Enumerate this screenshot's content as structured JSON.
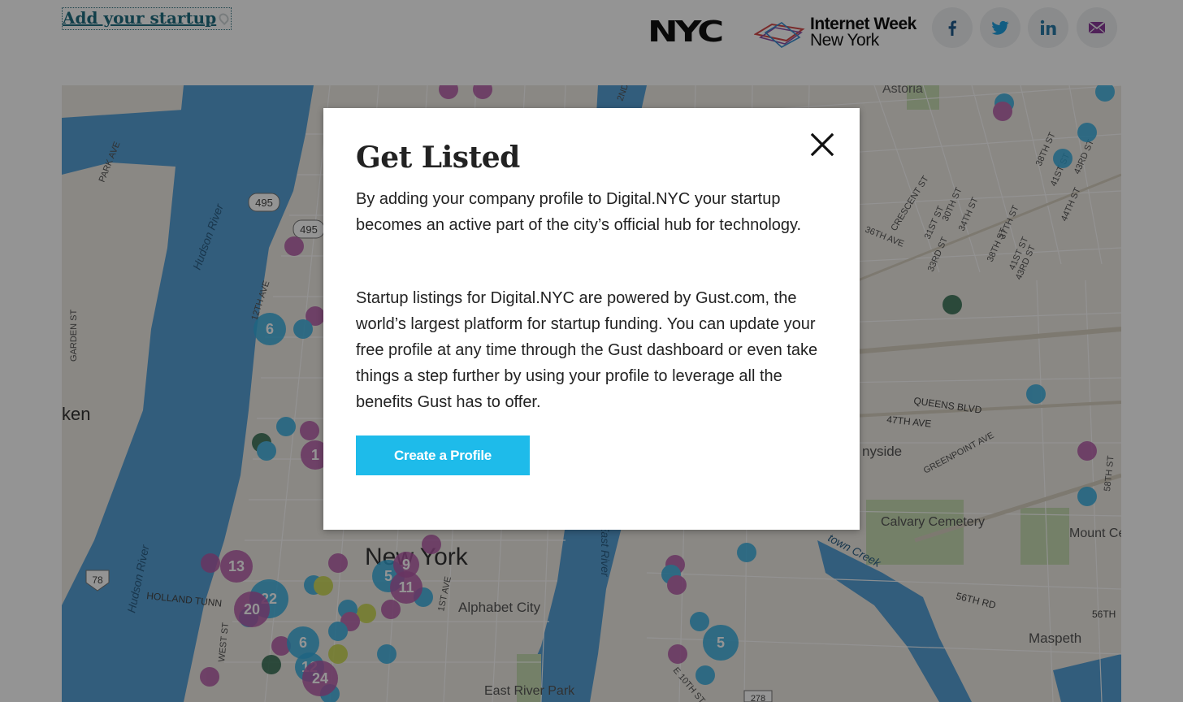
{
  "header": {
    "add_startup_link": "Add your startup",
    "nyc_logo": "NYC",
    "internet_week": {
      "line1": "Internet Week",
      "line2": "New York"
    },
    "social": [
      {
        "name": "facebook-icon",
        "color": "#1f5a8c"
      },
      {
        "name": "twitter-icon",
        "color": "#1fa0e0"
      },
      {
        "name": "linkedin-icon",
        "color": "#2a7aa8"
      },
      {
        "name": "email-icon",
        "color": "#8a3b9a"
      }
    ]
  },
  "map": {
    "labels": {
      "astoria": "Astoria",
      "park_ave": "PARK AVE",
      "hudson_river": "Hudson River",
      "hudson_river_2": "Hudson River",
      "rt495_a": "495",
      "rt495_b": "495",
      "rt78": "78",
      "rt278": "278",
      "ave12": "12TH AVE",
      "garden_st": "GARDEN ST",
      "ken": "ken",
      "holland": "HOLLAND TUNN",
      "west_st": "WEST ST",
      "new_york": "New York",
      "alphabet_city": "Alphabet City",
      "east_river": "East River",
      "east_river_park": "East River Park",
      "ave1": "1ST AVE",
      "ave10": "E 10TH ST",
      "queens_blvd": "QUEENS BLVD",
      "ave47": "47TH AVE",
      "greenpoint": "GREENPOINT AVE",
      "sunnyside": "nyside",
      "calvary": "Calvary Cemetery",
      "mount": "Mount Cemet",
      "newtown": "town Creek",
      "rd56": "56TH RD",
      "th56": "56TH",
      "maspeth": "Maspeth",
      "crescent": "CRESCENT ST",
      "ave36": "36TH AVE",
      "st31": "31ST ST",
      "st33": "33RD ST",
      "st30": "30TH ST",
      "st34": "34TH ST",
      "st38": "38TH ST",
      "st37": "37TH ST",
      "st41": "41ST ST",
      "st43": "43RD ST",
      "st44": "44TH ST",
      "st58": "58TH ST",
      "ave2": "2ND",
      "st38b": "38TH ST",
      "st41b": "41ST ST",
      "st43b": "43RD ST"
    },
    "cluster_counts": {
      "c6a": "6",
      "c1": "1",
      "c13": "13",
      "c22": "22",
      "c20": "20",
      "c6b": "6",
      "c24": "24",
      "c12": "12",
      "c5a": "5",
      "c9": "9",
      "c11": "11",
      "c5b": "5"
    },
    "colors": {
      "water": "#57a0d6",
      "land": "#eeeae3",
      "park": "#c9ddb4",
      "blue_pin": "#35aee0",
      "purple_pin": "#b45aa8",
      "green_pin": "#2e6b4f"
    }
  },
  "modal": {
    "title": "Get Listed",
    "paragraph1": "By adding your company profile to Digital.NYC your startup becomes an active part of the city’s official hub for technology.",
    "paragraph2": "Startup listings for Digital.NYC are powered by Gust.com, the world’s largest platform for startup funding. You can update your free profile at any time through the Gust dashboard or even take things a step further by using your profile to leverage all the benefits Gust has to offer.",
    "cta_label": "Create a Profile",
    "accent": "#1ebbea"
  }
}
